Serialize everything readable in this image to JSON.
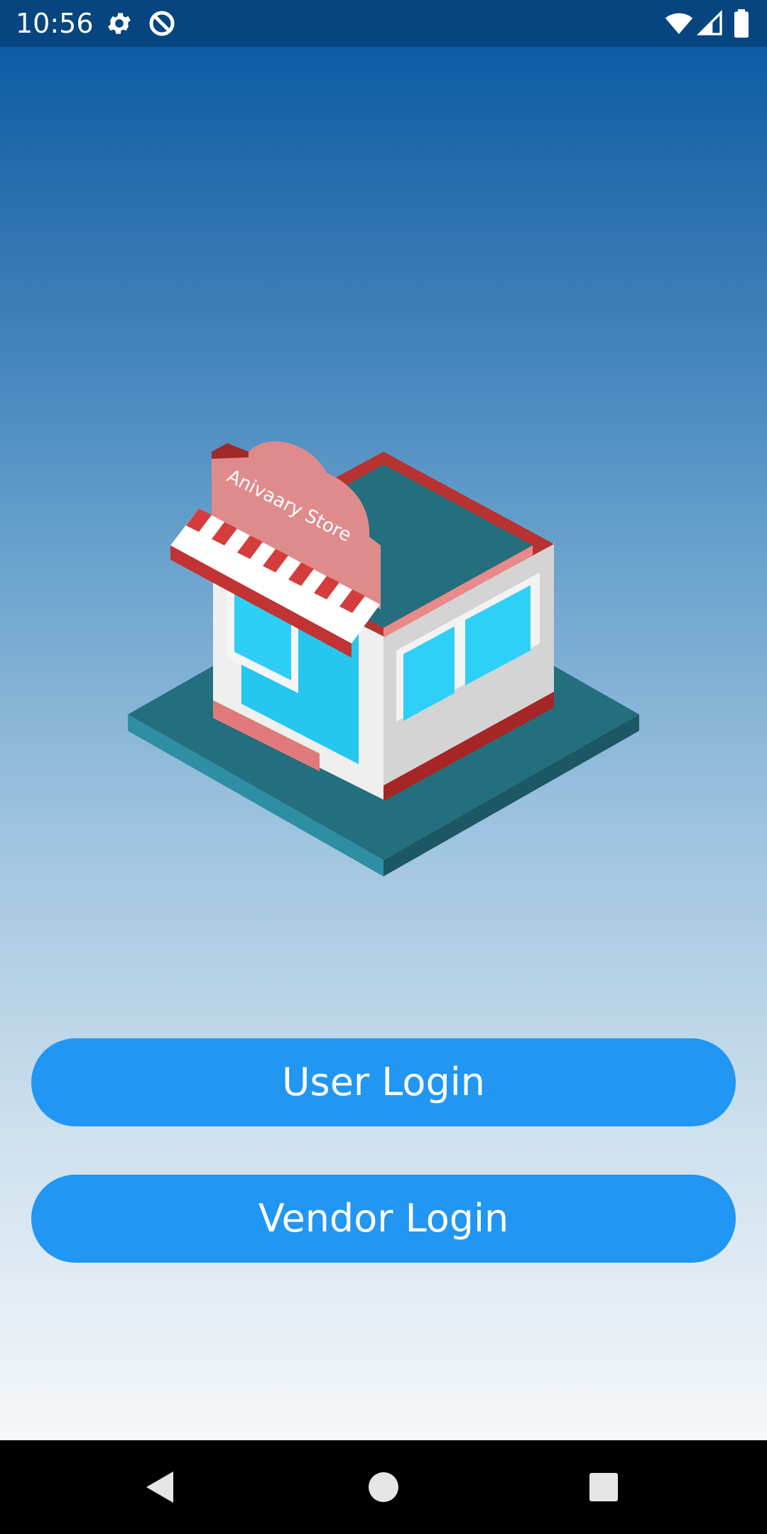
{
  "status_bar": {
    "time": "10:56",
    "icons": [
      "settings-icon",
      "data-saver-icon",
      "wifi-icon",
      "signal-icon",
      "battery-icon"
    ]
  },
  "main": {
    "illustration": {
      "name": "store-illustration",
      "sign_text": "Anivaary Store"
    },
    "buttons": {
      "user_login": "User Login",
      "vendor_login": "Vendor Login"
    }
  },
  "nav_bar": {
    "icons": [
      "back-icon",
      "home-icon",
      "recents-icon"
    ]
  },
  "colors": {
    "status_bar": "#06457f",
    "gradient_top": "#0d5ca3",
    "gradient_bottom": "#f6f8fa",
    "button": "#2196f3",
    "button_text": "#ffffff"
  }
}
